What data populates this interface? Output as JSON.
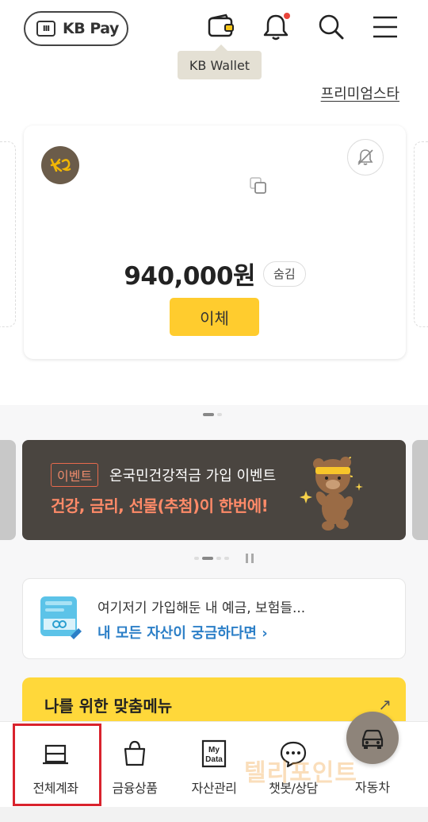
{
  "header": {
    "brand_badge": "III",
    "brand_label": "KB Pay",
    "wallet_tooltip": "KB Wallet",
    "premium_link": "프리미엄스타"
  },
  "account": {
    "balance": "940,000원",
    "hide_button": "숨김",
    "transfer_button": "이체"
  },
  "event_banner": {
    "tag": "이벤트",
    "title": "온국민건강적금 가입 이벤트",
    "subtitle": "건강, 금리, 선물(추첨)이 한번에!"
  },
  "assets_card": {
    "line1": "여기저기 가입해둔 내 예금, 보험들...",
    "line2": "내 모든 자산이 궁금하다면 ›"
  },
  "menu_card": {
    "title": "나를 위한 맞춤메뉴",
    "arrow": "↗"
  },
  "bottom_nav": {
    "items": [
      {
        "label": "전체계좌",
        "icon": "account-icon"
      },
      {
        "label": "금융상품",
        "icon": "shopping-bag-icon"
      },
      {
        "label": "자산관리",
        "icon": "mydata-icon"
      },
      {
        "label": "챗봇/상담",
        "icon": "chat-icon"
      },
      {
        "label": "자동차",
        "icon": "car-icon"
      }
    ],
    "mydata_icon_text": "My Data"
  },
  "watermark": "텔리포인트",
  "colors": {
    "accent_yellow": "#ffcc2e",
    "banner_bg": "#4a4540",
    "banner_accent": "#ff8a68",
    "link_blue": "#2c7fc7",
    "selection_red": "#d9232d"
  }
}
